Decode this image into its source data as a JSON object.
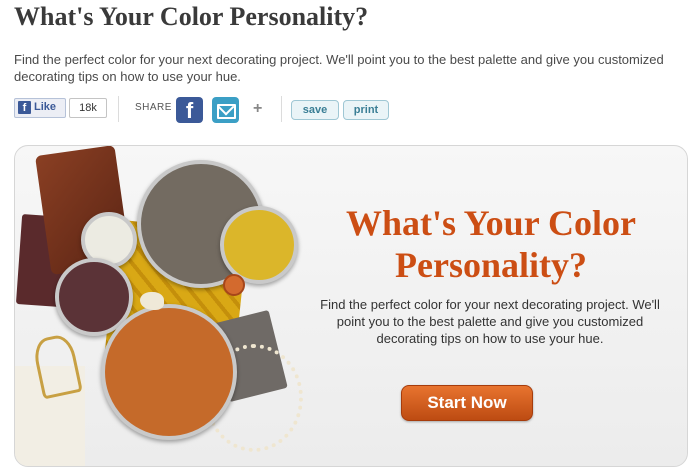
{
  "page": {
    "title": "What's Your Color Personality?",
    "intro": "Find the perfect color for your next decorating project. We'll point you to the best palette and give you customized decorating tips on how to use your hue."
  },
  "share_bar": {
    "like_label": "Like",
    "like_count": "18k",
    "share_label": "SHARE",
    "plus_label": "+",
    "save_label": "save",
    "print_label": "print"
  },
  "promo": {
    "title": "What's Your Color Personality?",
    "description": "Find the perfect color for your next decorating project. We'll point you to the best palette and give you customized decorating tips on how to use your hue.",
    "button_label": "Start Now"
  },
  "icons": {
    "facebook_like": "facebook-icon",
    "facebook_share": "facebook-icon",
    "email_share": "envelope-icon",
    "plus": "plus-icon"
  },
  "colors": {
    "accent_orange": "#cc4e14",
    "facebook_blue": "#3b5998",
    "email_blue": "#3b9fc5"
  }
}
